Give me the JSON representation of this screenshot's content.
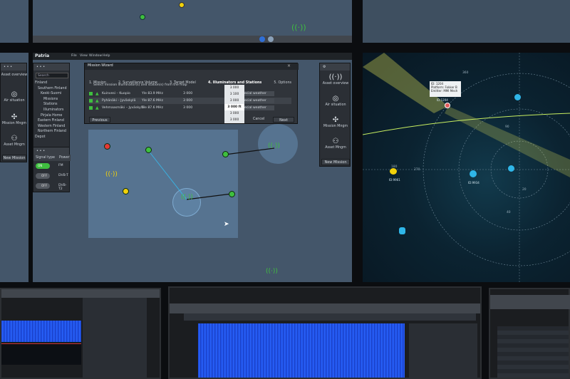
{
  "app": {
    "brand": "Patria",
    "menu": [
      "File",
      "View",
      "Window",
      "Help"
    ]
  },
  "tree_panel": {
    "search_placeholder": "Search",
    "items": [
      {
        "label": "Finland",
        "level": 0
      },
      {
        "label": "Southern Finland",
        "level": 1
      },
      {
        "label": "Keski-Suomi",
        "level": 2
      },
      {
        "label": "Missions",
        "level": 3
      },
      {
        "label": "Stations",
        "level": 3
      },
      {
        "label": "Illuminators",
        "level": 3
      },
      {
        "label": "Pirjala Home",
        "level": 2
      },
      {
        "label": "Eastern Finland",
        "level": 1
      },
      {
        "label": "Western Finland",
        "level": 1
      },
      {
        "label": "Northern Finland",
        "level": 1
      },
      {
        "label": "Depot",
        "level": 0
      }
    ]
  },
  "signal_panel": {
    "header_left": "Signal type",
    "header_right": "Power",
    "rows": [
      {
        "toggle": "ON",
        "label": "FM"
      },
      {
        "toggle": "OFF",
        "label": "DVB-T"
      },
      {
        "toggle": "OFF",
        "label": "DVB-T2"
      }
    ]
  },
  "left_assets": {
    "items": [
      "Asset overview",
      "Air situation",
      "Mission Mngm",
      "Asset Mngm"
    ],
    "new_mission": "New Mission"
  },
  "right_assets": {
    "items": [
      "Asset overview",
      "Air situation",
      "Mission Mngm",
      "Asset Mngm"
    ],
    "new_mission": "New Mission"
  },
  "wizard": {
    "title": "Mission Wizard",
    "steps": [
      "1. Mission",
      "2. Surveillance Volume",
      "3. Target Model",
      "4. Illuminators and Stations",
      "5. Options"
    ],
    "active_step": 3,
    "instruction": "Select mission illuminator(s) and station(s) from the map",
    "rows": [
      {
        "name": "Kuinvesi – Kuopio",
        "freq": "Yle 83.9 MHz",
        "power": "3 000",
        "weather": "Special weather"
      },
      {
        "name": "Pyhänäki – Jyväskylä",
        "freq": "Yle 87.6 MHz",
        "power": "3 000",
        "weather": "Special weather"
      },
      {
        "name": "Vehmaasmäki – Jyväskylä",
        "freq": "Yle 87.6 MHz",
        "power": "3 000",
        "weather": "Special weather"
      }
    ],
    "dropdown_options": [
      "3 000",
      "3 100",
      "3 000",
      "3 000 ft",
      "3 000",
      "3 000"
    ],
    "previous_label": "Previous",
    "cancel_label": "Cancel",
    "next_label": "Next"
  },
  "radar": {
    "tooltip": [
      {
        "key": "ID:",
        "value": "1204"
      },
      {
        "key": "Platform:",
        "value": "Fokker B"
      },
      {
        "key": "Emitter:",
        "value": "MMI Mech"
      }
    ],
    "ring_labels": [
      "360",
      "270",
      "180",
      "90",
      "40",
      "20"
    ],
    "track_labels": [
      "ID:9961",
      "ID:9934",
      "ID:1204"
    ]
  },
  "colors": {
    "accent": "#2f6fd6",
    "active": "#3fbf3f",
    "alert": "#e53935",
    "warning": "#f2d20a",
    "radar_track": "#2fb6e8"
  }
}
